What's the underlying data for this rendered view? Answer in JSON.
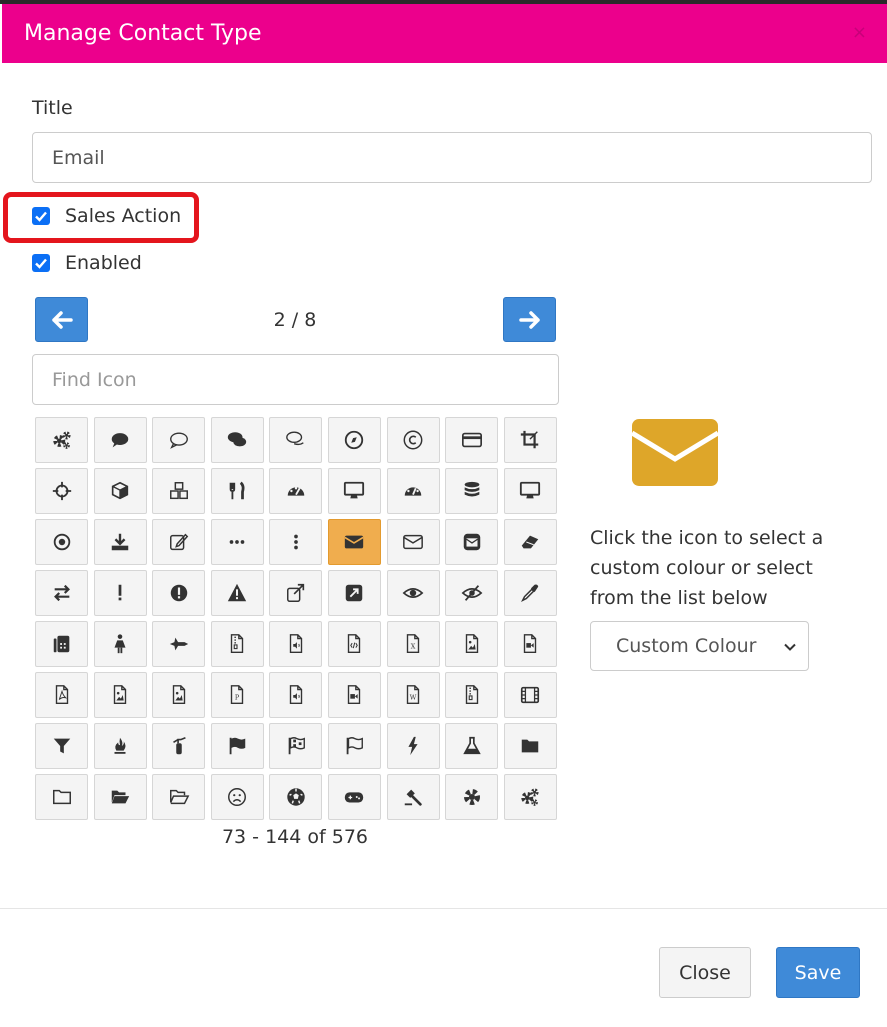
{
  "dialog": {
    "title": "Manage Contact Type",
    "close_glyph": "×"
  },
  "form": {
    "title_label": "Title",
    "title_value": "Email",
    "sales_action_label": "Sales Action",
    "sales_action_checked": true,
    "enabled_label": "Enabled",
    "enabled_checked": true
  },
  "icon_picker": {
    "prev_icon": "arrow-left-icon",
    "next_icon": "arrow-right-icon",
    "page_info": "2 / 8",
    "search_placeholder": "Find Icon",
    "range_text": "73 - 144 of 576",
    "selected_icon": "envelope",
    "icons": [
      "cogs",
      "comment",
      "comment-o",
      "comments",
      "comments-o",
      "compass",
      "copyright",
      "credit-card",
      "crop",
      "crosshairs",
      "cube",
      "cubes",
      "cutlery",
      "dashboard",
      "desktop",
      "tachometer",
      "database",
      "desktop-alt",
      "dot-circle-o",
      "download",
      "edit",
      "ellipsis-h",
      "ellipsis-v",
      "envelope",
      "envelope-o",
      "envelope-square",
      "eraser",
      "exchange",
      "exclamation",
      "exclamation-circle",
      "exclamation-triangle",
      "external-link",
      "external-link-square",
      "eye",
      "eye-slash",
      "eyedropper",
      "fax",
      "female",
      "fighter-jet",
      "file-archive-o",
      "file-audio-o",
      "file-code-o",
      "file-excel-o",
      "file-image-o",
      "file-movie-o",
      "file-pdf-o",
      "file-photo-o",
      "file-picture-o",
      "file-powerpoint-o",
      "file-sound-o",
      "file-video-o",
      "file-word-o",
      "file-zip-o",
      "film",
      "filter",
      "fire",
      "fire-extinguisher",
      "flag",
      "flag-checkered",
      "flag-o",
      "flash",
      "flask",
      "folder",
      "folder-o",
      "folder-open",
      "folder-open-o",
      "frown-o",
      "futbol-o",
      "gamepad",
      "gavel",
      "gear",
      "gears"
    ]
  },
  "preview": {
    "icon": "envelope-icon",
    "color": "#dea629",
    "hint": "Click the icon to select a custom colour or select from the list below"
  },
  "colour_select": {
    "selected": "Custom Colour"
  },
  "footer": {
    "close_label": "Close",
    "save_label": "Save"
  },
  "colors": {
    "header": "#ec008c",
    "primary": "#3f8ad8",
    "selected_cell": "#f0ad4e",
    "highlight": "#e4151d"
  }
}
